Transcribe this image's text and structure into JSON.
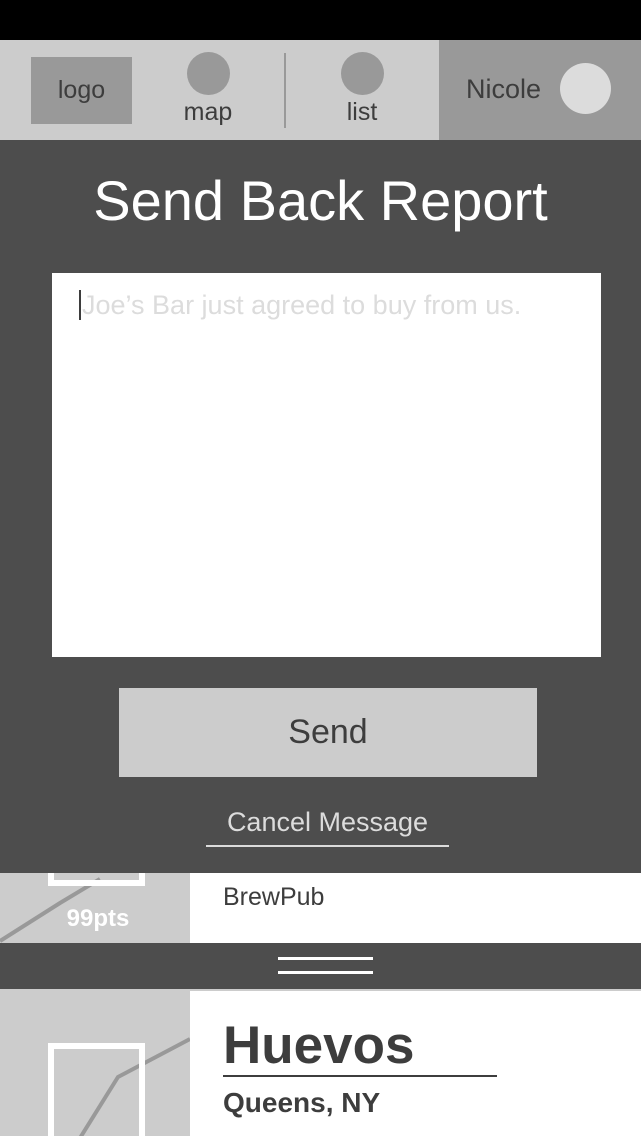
{
  "navbar": {
    "logo_label": "logo",
    "map_label": "map",
    "list_label": "list",
    "user_name": "Nicole"
  },
  "modal": {
    "title": "Send Back Report",
    "message_placeholder": "Joe’s Bar just agreed to buy from us.",
    "send_label": "Send",
    "cancel_label": "Cancel Message"
  },
  "list": {
    "items": [
      {
        "points": "99pts",
        "name": "BrewPub"
      },
      {
        "name": "Huevos",
        "location": "Queens, NY"
      }
    ]
  },
  "colors": {
    "navbar_bg": "#cccccc",
    "modal_bg": "#4d4d4d",
    "accent_gray": "#999999",
    "text_dark": "#3d3d3d"
  }
}
